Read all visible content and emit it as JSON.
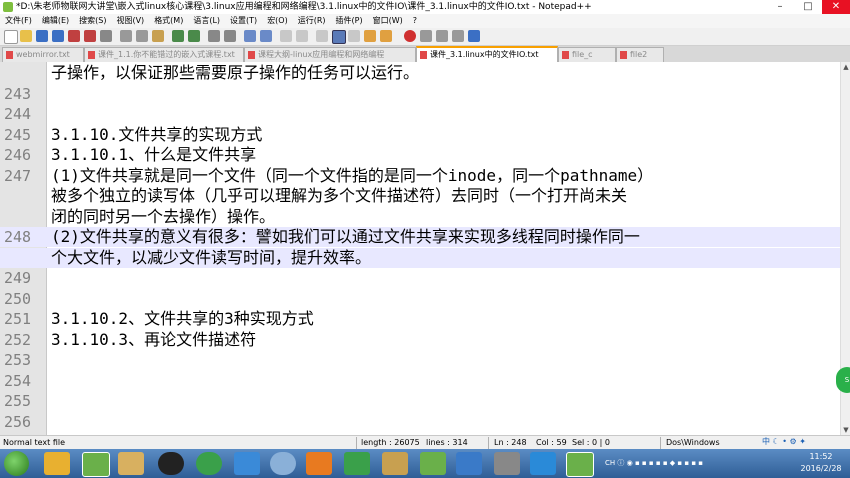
{
  "window": {
    "title": "*D:\\朱老师物联网大讲堂\\嵌入式linux核心课程\\3.linux应用编程和网络编程\\3.1.linux中的文件IO\\课件_3.1.linux中的文件IO.txt - Notepad++",
    "minimize": "–",
    "maximize": "□",
    "close": "✕"
  },
  "menu": [
    "文件(F)",
    "编辑(E)",
    "搜索(S)",
    "视图(V)",
    "格式(M)",
    "语言(L)",
    "设置(T)",
    "宏(O)",
    "运行(R)",
    "插件(P)",
    "窗口(W)",
    "?"
  ],
  "tabs": [
    {
      "label": "webmirror.txt"
    },
    {
      "label": "课件_1.1.你不能错过的嵌入式课程.txt"
    },
    {
      "label": "课程大纲-linux应用编程和网络编程"
    },
    {
      "label": "课件_3.1.linux中的文件IO.txt",
      "active": true
    },
    {
      "label": "file_c"
    },
    {
      "label": "file2"
    }
  ],
  "editor": {
    "lines": [
      {
        "num": "",
        "text": "子操作，以保证那些需要原子操作的任务可以运行。"
      },
      {
        "num": "243",
        "text": ""
      },
      {
        "num": "244",
        "text": ""
      },
      {
        "num": "245",
        "text": "3.1.10.文件共享的实现方式"
      },
      {
        "num": "246",
        "text": "3.1.10.1、什么是文件共享"
      },
      {
        "num": "247",
        "text": "(1)文件共享就是同一个文件（同一个文件指的是同一个inode，同一个pathname）"
      },
      {
        "num": "",
        "text": "被多个独立的读写体（几乎可以理解为多个文件描述符）去同时（一个打开尚未关"
      },
      {
        "num": "",
        "text": "闭的同时另一个去操作）操作。"
      },
      {
        "num": "248",
        "text": "(2)文件共享的意义有很多：譬如我们可以通过文件共享来实现多线程同时操作同一",
        "highlight": true
      },
      {
        "num": "",
        "text": "个大文件，以减少文件读写时间，提升效率。",
        "highlight": true
      },
      {
        "num": "249",
        "text": ""
      },
      {
        "num": "250",
        "text": ""
      },
      {
        "num": "251",
        "text": "3.1.10.2、文件共享的3种实现方式"
      },
      {
        "num": "252",
        "text": "3.1.10.3、再论文件描述符"
      },
      {
        "num": "253",
        "text": ""
      },
      {
        "num": "254",
        "text": ""
      },
      {
        "num": "255",
        "text": ""
      },
      {
        "num": "256",
        "text": ""
      }
    ]
  },
  "status": {
    "type": "Normal text file",
    "length": "length : 26075",
    "lines": "lines : 314",
    "ln": "Ln : 248",
    "col": "Col : 59",
    "sel": "Sel : 0 | 0",
    "eol": "Dos\\Windows"
  },
  "ime": {
    "label": "中"
  },
  "taskbar": {
    "tray_text": "CH",
    "time": "11:52",
    "date": "2016/2/28"
  },
  "colors": {
    "highlight_line": "#e8e8ff",
    "active_tab_accent": "#f8a000",
    "taskbar": "#3a6ea5"
  }
}
